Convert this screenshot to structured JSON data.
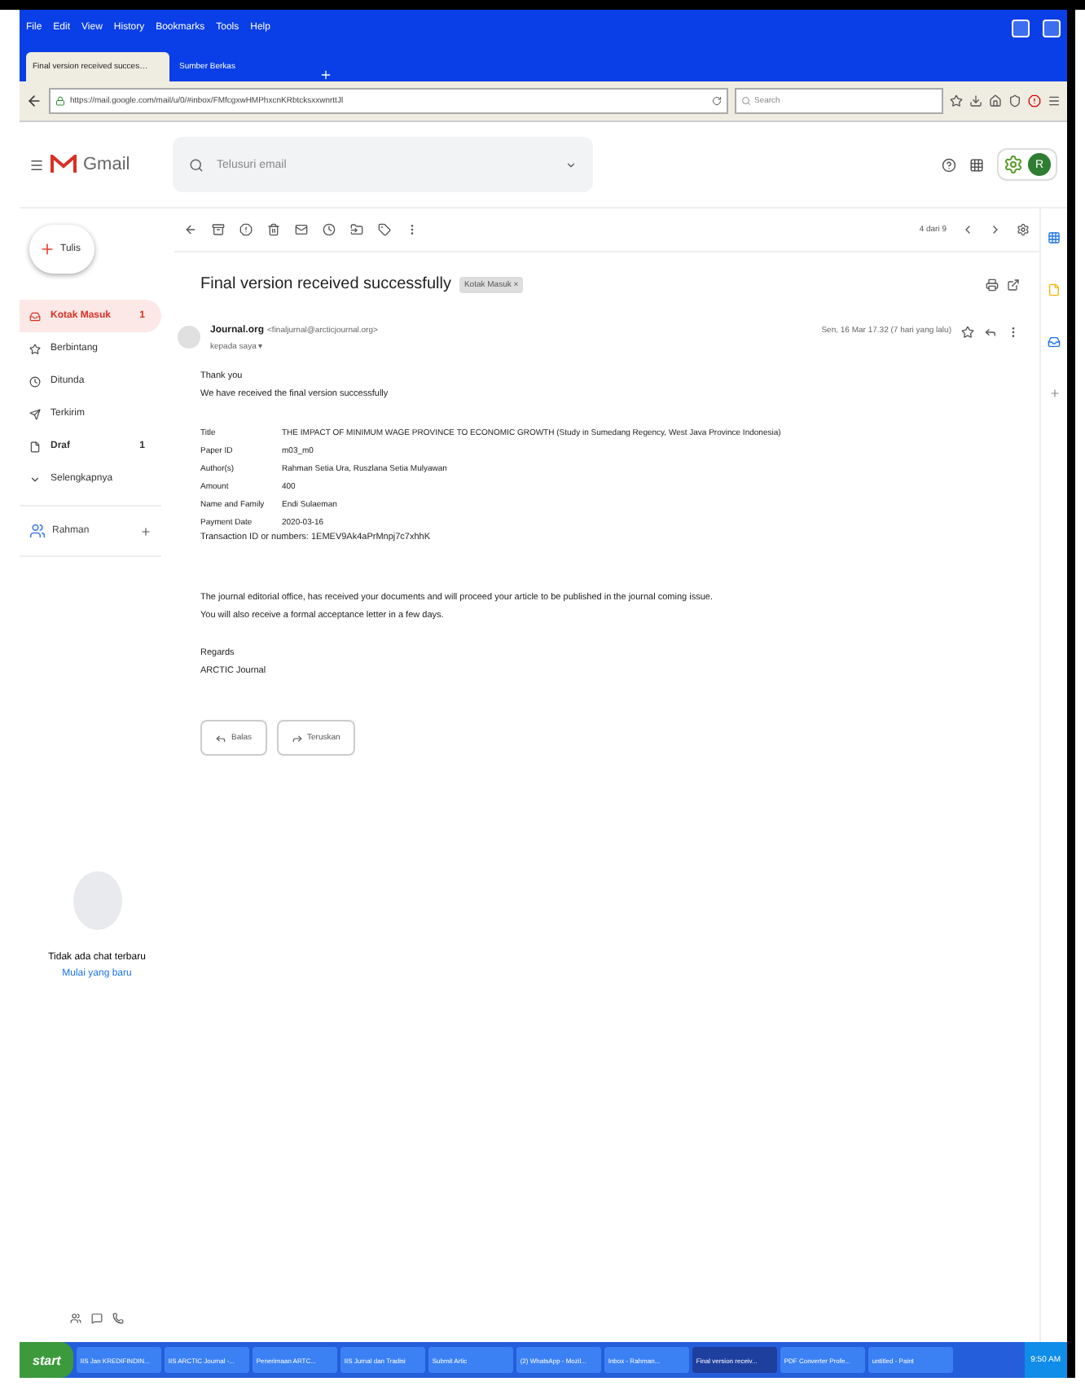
{
  "browser": {
    "menu": [
      "File",
      "Edit",
      "View",
      "History",
      "Bookmarks",
      "Tools",
      "Help"
    ],
    "tabs": [
      {
        "title": "Final version received succes…",
        "selected": true
      },
      {
        "title": "Sumber Berkas",
        "selected": false
      }
    ],
    "url": "https://mail.google.com/mail/u/0/#inbox/FMfcgxwHMPhxcnKRbtcksxxwnrttJl",
    "search": {
      "placeholder": "Search"
    }
  },
  "gmail": {
    "logo": "Gmail",
    "search": {
      "placeholder": "Telusuri email"
    },
    "avatar": "R",
    "compose": "Tulis",
    "sidebar": [
      {
        "label": "Kotak Masuk",
        "count": "1",
        "selected": true,
        "bold": true
      },
      {
        "label": "Berbintang",
        "selected": false,
        "bold": false
      },
      {
        "label": "Ditunda",
        "selected": false,
        "bold": false
      },
      {
        "label": "Terkirim",
        "selected": false,
        "bold": false
      },
      {
        "label": "Draf",
        "count": "1",
        "selected": false,
        "bold": true
      },
      {
        "label": "Selengkapnya",
        "selected": false,
        "bold": false
      }
    ],
    "account": "Rahman",
    "chat": {
      "empty": "Tidak ada chat terbaru",
      "start": "Mulai yang baru"
    },
    "pager": "4 dari 9",
    "message": {
      "subject": "Final version received successfully",
      "label": "Kotak Masuk ×",
      "sender": "Journal.org",
      "address": "<finaljurnal@arcticjournal.org>",
      "to": "kepada saya ▾",
      "date": "Sen, 16 Mar 17.32 (7 hari yang lalu)",
      "intro": [
        "Thank you",
        "We have received the final version successfully"
      ],
      "fields": [
        {
          "label": "Title",
          "value": "THE IMPACT OF MINIMUM WAGE PROVINCE TO ECONOMIC GROWTH (Study in Sumedang Regency, West Java Province Indonesia)"
        },
        {
          "label": "Paper ID",
          "value": "m03_m0"
        },
        {
          "label": "Author(s)",
          "value": "Rahman Setia Ura, Ruszlana Setia Mulyawan"
        },
        {
          "label": "Amount",
          "value": "400"
        },
        {
          "label": "Name and Family",
          "value": "Endi Sulaeman"
        },
        {
          "label": "Payment Date",
          "value": "2020-03-16"
        }
      ],
      "transaction": "Transaction ID or numbers: 1EMEV9Ak4aPrMnpj7c7xhhK",
      "body": [
        "The journal editorial office, has received your documents and will proceed your article to be published in the journal coming issue.",
        "You will also receive a formal acceptance letter in a few days."
      ],
      "closing": [
        "Regards",
        "ARCTIC Journal"
      ],
      "buttons": [
        "Balas",
        "Teruskan"
      ]
    }
  },
  "taskbar": {
    "start": "start",
    "items": [
      {
        "title": "IIS Jan KREDIFINDIN...",
        "selected": false
      },
      {
        "title": "IIS ARCTIC Journal -...",
        "selected": false
      },
      {
        "title": "Penerimaan ARTC...",
        "selected": false
      },
      {
        "title": "IIS Jurnal dan Tradisi",
        "selected": false
      },
      {
        "title": "Submit Artic",
        "selected": false
      },
      {
        "title": "(2) WhatsApp - Mozil...",
        "selected": false
      },
      {
        "title": "Inbox - Rahman...",
        "selected": false
      },
      {
        "title": "Final version receiv...",
        "selected": true
      },
      {
        "title": "PDF Converter Profe...",
        "selected": false
      },
      {
        "title": "untitled - Paint",
        "selected": false
      }
    ],
    "clock": "9:50 AM"
  }
}
